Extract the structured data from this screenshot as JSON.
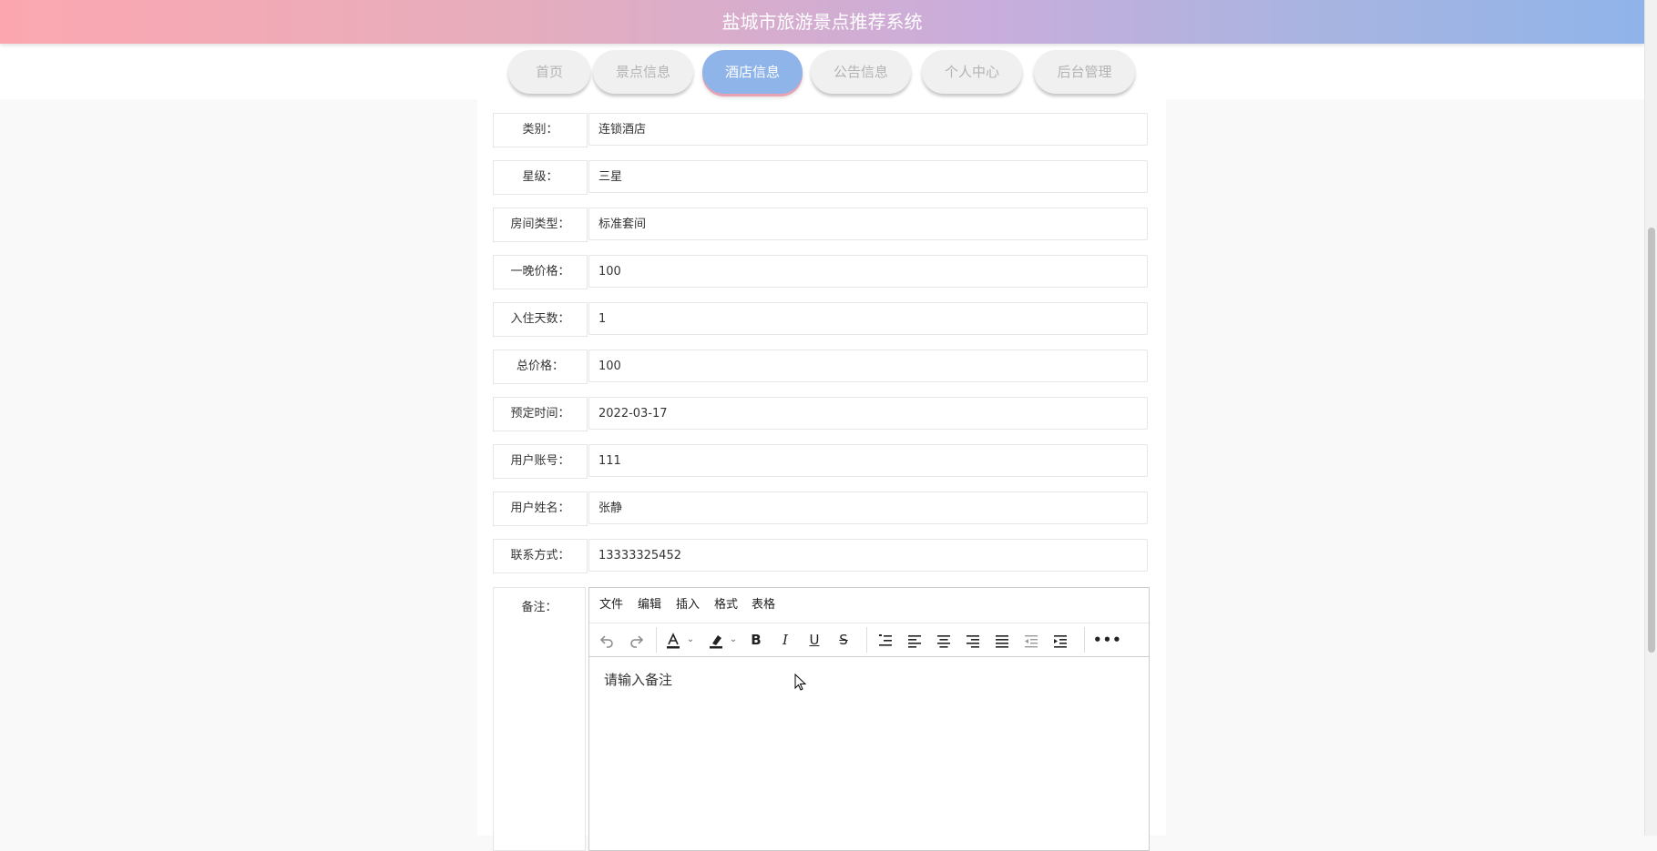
{
  "header": {
    "title": "盐城市旅游景点推荐系统"
  },
  "nav": {
    "items": [
      "首页",
      "景点信息",
      "酒店信息",
      "公告信息",
      "个人中心",
      "后台管理"
    ],
    "active_index": 2
  },
  "form": {
    "fields": [
      {
        "label": "类别：",
        "value": "连锁酒店"
      },
      {
        "label": "星级：",
        "value": "三星"
      },
      {
        "label": "房间类型：",
        "value": "标准套间"
      },
      {
        "label": "一晚价格：",
        "value": "100"
      },
      {
        "label": "入住天数：",
        "value": "1"
      },
      {
        "label": "总价格：",
        "value": "100"
      },
      {
        "label": "预定时间：",
        "value": "2022-03-17"
      },
      {
        "label": "用户账号：",
        "value": "111"
      },
      {
        "label": "用户姓名：",
        "value": "张静"
      },
      {
        "label": "联系方式：",
        "value": "13333325452"
      }
    ],
    "note_label": "备注："
  },
  "editor": {
    "menu": [
      "文件",
      "编辑",
      "插入",
      "格式",
      "表格"
    ],
    "toolbar_icons": [
      "undo-icon",
      "redo-icon",
      "text-color-icon",
      "highlight-icon",
      "bold-icon",
      "italic-icon",
      "underline-icon",
      "strikethrough-icon",
      "line-height-icon",
      "align-left-icon",
      "align-center-icon",
      "align-right-icon",
      "align-justify-icon",
      "outdent-icon",
      "indent-icon",
      "more-icon"
    ],
    "placeholder": "请输入备注"
  },
  "colors": {
    "header_gradient_start": "#fca7b0",
    "header_gradient_end": "#8fb4ea",
    "nav_active": "#8fb4ea",
    "nav_active_underline": "#e7a2b4",
    "nav_inactive": "#f0f0f0"
  }
}
